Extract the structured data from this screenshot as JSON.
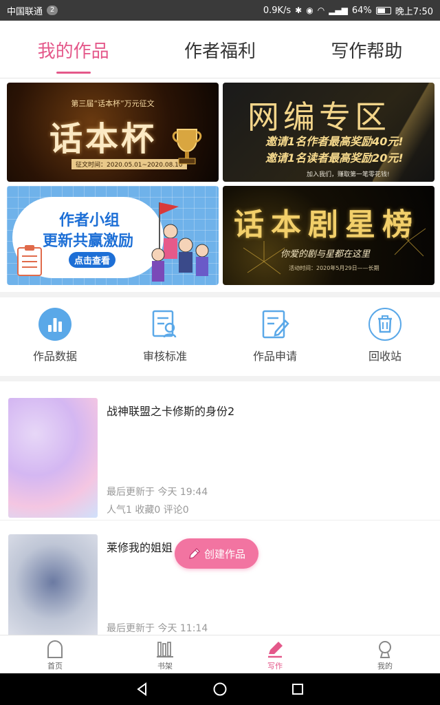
{
  "status_bar": {
    "carrier": "中国联通",
    "sim_badge": "2",
    "speed": "0.9K/s",
    "signal": "4G",
    "battery": "64%",
    "battery_level": 0.64,
    "time": "晚上7:50"
  },
  "tabs": [
    {
      "label": "我的作品",
      "active": true
    },
    {
      "label": "作者福利",
      "active": false
    },
    {
      "label": "写作帮助",
      "active": false
    }
  ],
  "banners": {
    "b1": {
      "subtitle": "第三届“话本杯”万元征文",
      "title": "话本杯",
      "date": "征文时间：2020.05.01~2020.08.10"
    },
    "b2": {
      "title": "网编专区",
      "line1": "邀请1名作者最高奖励40元!",
      "line2": "邀请1名读者最高奖励20元!",
      "line3": "加入我们，赚取第一笔零花钱!"
    },
    "b3": {
      "line1": "作者小组",
      "line2": "更新共赢激励",
      "button": "点击查看"
    },
    "b4": {
      "title": "话本剧星榜",
      "subtitle": "你爱的剧与星都在这里",
      "date": "活动时间：2020年5月29日——长期"
    }
  },
  "actions": [
    {
      "label": "作品数据",
      "icon": "bar-chart-icon"
    },
    {
      "label": "审核标准",
      "icon": "review-standard-icon"
    },
    {
      "label": "作品申请",
      "icon": "application-icon"
    },
    {
      "label": "回收站",
      "icon": "trash-icon"
    }
  ],
  "works": [
    {
      "title": "战神联盟之卡修斯的身份2",
      "updated": "最后更新于 今天 19:44",
      "stats": "人气1 收藏0 评论0"
    },
    {
      "title": "莱修我的姐姐",
      "updated": "最后更新于 今天 11:14",
      "stats": ""
    }
  ],
  "fab": {
    "label": "创建作品",
    "icon": "pencil-icon"
  },
  "bottom_nav": [
    {
      "label": "首页",
      "icon": "home-icon",
      "active": false
    },
    {
      "label": "书架",
      "icon": "bookshelf-icon",
      "active": false
    },
    {
      "label": "写作",
      "icon": "pen-icon",
      "active": true
    },
    {
      "label": "我的",
      "icon": "profile-icon",
      "active": false
    }
  ],
  "colors": {
    "accent": "#e4588a",
    "fab": "#f274a1",
    "action_blue": "#5aa8e8"
  }
}
